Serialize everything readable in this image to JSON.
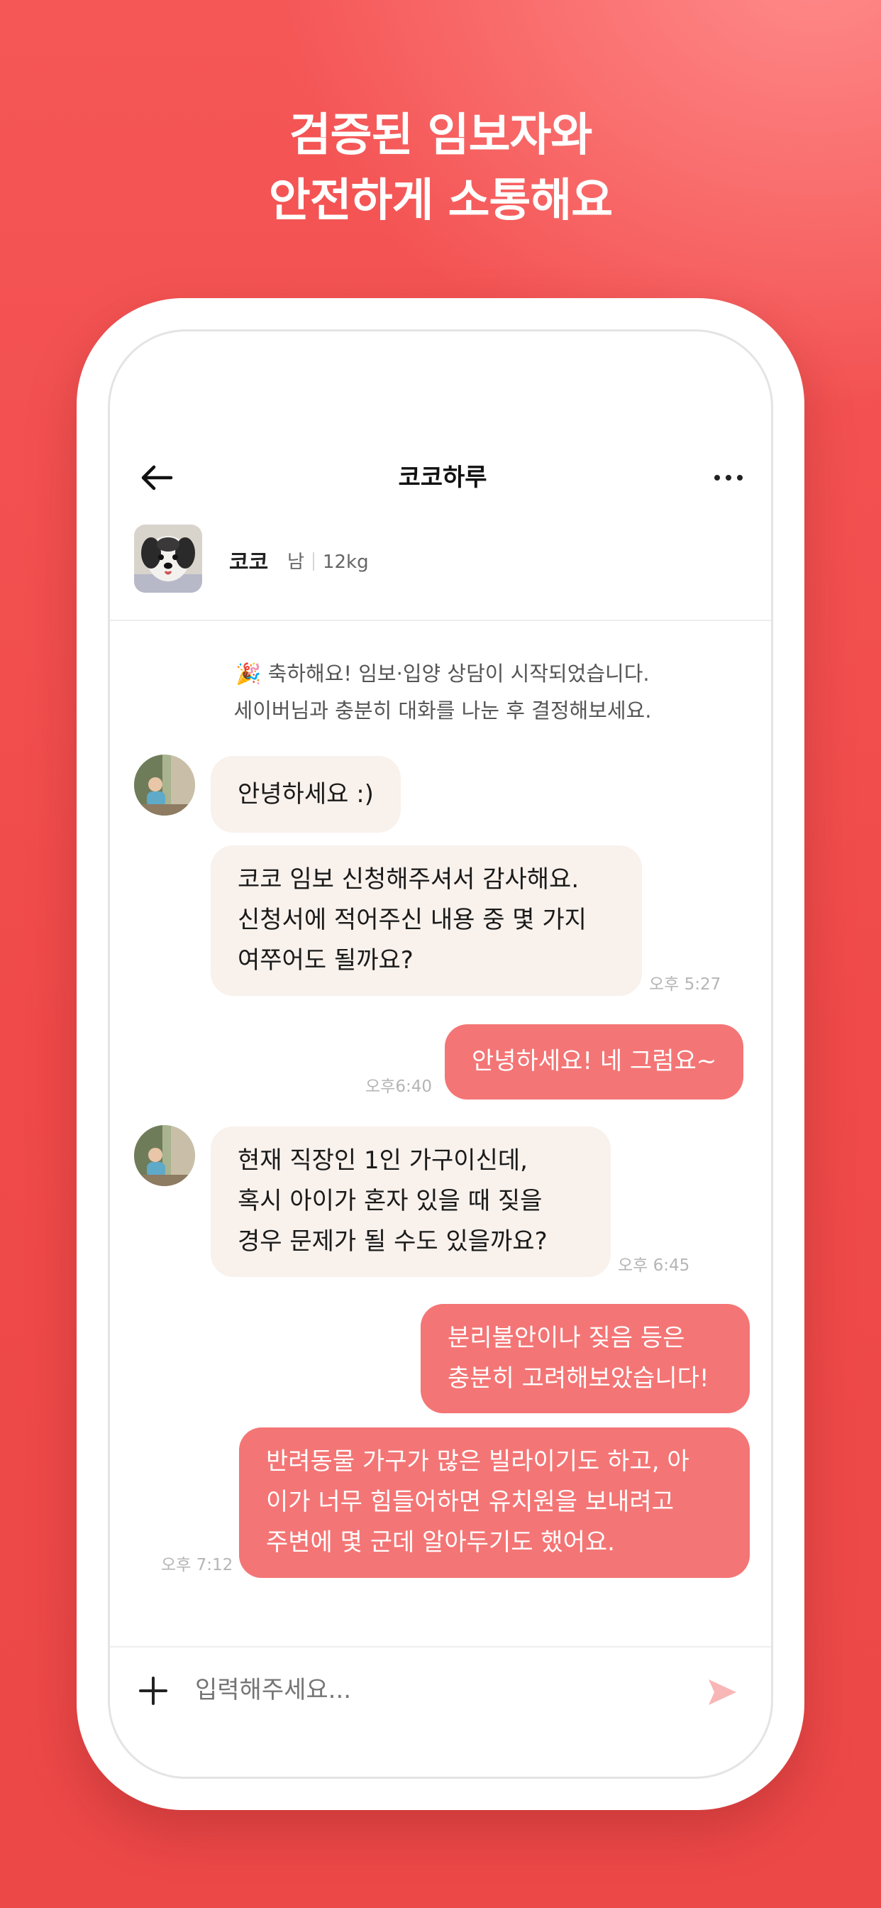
{
  "headline": {
    "line1": "검증된 임보자와",
    "line2": "안전하게 소통해요"
  },
  "nav": {
    "back_icon": "arrow-left-icon",
    "title": "코코하루",
    "more_icon": "more-horizontal-icon"
  },
  "pet": {
    "name": "코코",
    "sex": "남",
    "weight": "12kg"
  },
  "notice": {
    "line1": "🎉 축하해요! 임보·입양 상담이 시작되었습니다.",
    "line2": "세이버님과 충분히 대화를 나눈 후 결정해보세요."
  },
  "messages": [
    {
      "side": "in",
      "lines": [
        "안녕하세요 :)"
      ],
      "time": ""
    },
    {
      "side": "in",
      "lines": [
        "코코 임보 신청해주셔서 감사해요.",
        "신청서에 적어주신 내용 중 몇 가지",
        "여쭈어도 될까요?"
      ],
      "time": "오후 5:27"
    },
    {
      "side": "out",
      "lines": [
        "안녕하세요! 네 그럼요~"
      ],
      "time": "오후6:40"
    },
    {
      "side": "in",
      "lines": [
        "현재 직장인 1인 가구이신데,",
        "혹시 아이가 혼자 있을 때 짖을",
        "경우 문제가 될 수도 있을까요?"
      ],
      "time": "오후 6:45"
    },
    {
      "side": "out",
      "lines": [
        "분리불안이나 짖음 등은",
        "충분히 고려해보았습니다!"
      ],
      "time": ""
    },
    {
      "side": "out",
      "lines": [
        "반려동물 가구가 많은 빌라이기도 하고, 아",
        "이가 너무 힘들어하면 유치원을 보내려고",
        "주변에 몇 군데 알아두기도 했어요."
      ],
      "time": "오후 7:12"
    }
  ],
  "input": {
    "placeholder": "입력해주세요...",
    "plus_icon": "plus-icon",
    "send_icon": "send-icon"
  },
  "colors": {
    "background": "#f24f4f",
    "outgoing_bubble": "#f47575",
    "incoming_bubble": "#f8f1ec"
  }
}
